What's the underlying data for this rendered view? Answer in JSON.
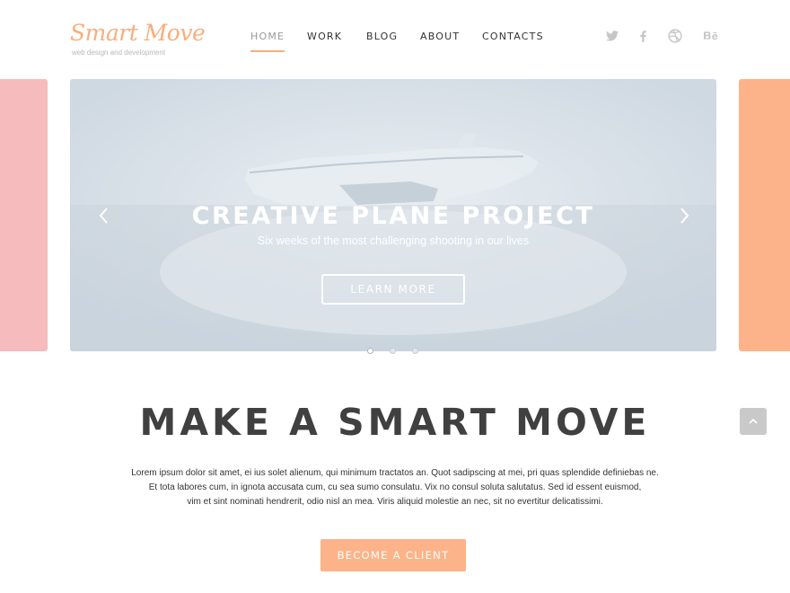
{
  "logo": {
    "title": "Smart Move",
    "tagline": "web design and development"
  },
  "nav": {
    "items": [
      {
        "label": "HOME",
        "active": true
      },
      {
        "label": "WORK",
        "active": false
      },
      {
        "label": "BLOG",
        "active": false
      },
      {
        "label": "ABOUT",
        "active": false
      },
      {
        "label": "CONTACTS",
        "active": false
      }
    ]
  },
  "social": [
    "twitter-icon",
    "facebook-icon",
    "dribbble-icon",
    "behance-icon"
  ],
  "hero": {
    "title": "CREATIVE PLANE PROJECT",
    "subtitle": "Six weeks of the most challenging shooting in our lives",
    "button_label": "LEARN MORE",
    "slide_count": 3,
    "active_slide": 1
  },
  "content": {
    "heading": "MAKE A SMART MOVE",
    "paragraph_lines": [
      "Lorem ipsum dolor sit amet, ei ius solet alienum, qui minimum tractatos an. Quot sadipscing at mei, pri quas splendide definiebas ne.",
      "Et tota labores cum, in ignota accusata cum, cu sea sumo consulatu. Vix no consul soluta salutatus. Sed id essent euismod,",
      "vim et sint nominati hendrerit, odio nisl an mea. Viris aliquid molestie an nec, sit no evertitur delicatissimi."
    ],
    "cta_label": "BECOME A CLIENT"
  },
  "colors": {
    "accent": "#fdb389",
    "logo": "#f9ae7c",
    "left_panel": "#f5bbbd",
    "hero_bg": "#d3dde5"
  }
}
